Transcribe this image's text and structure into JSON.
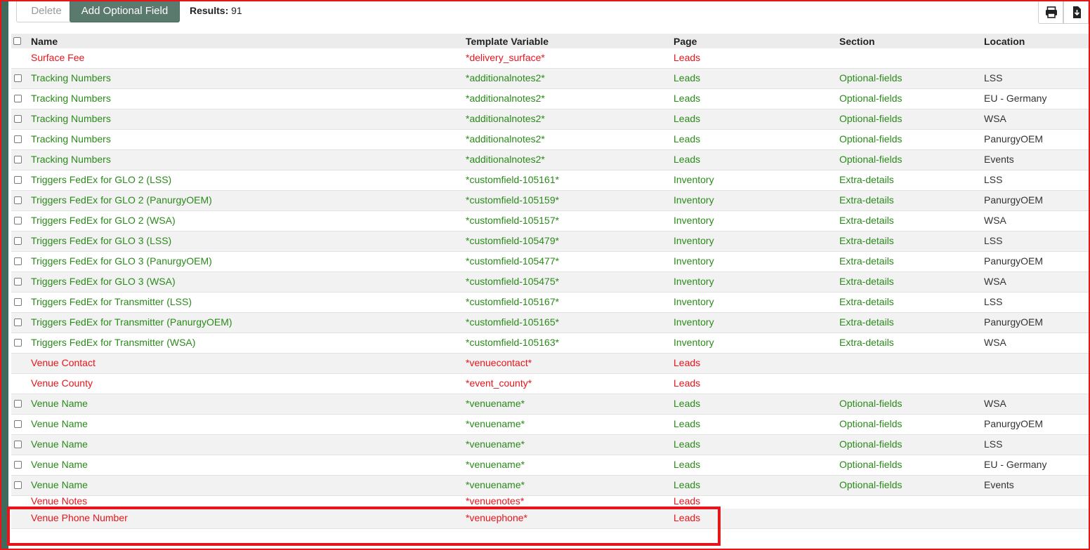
{
  "toolbar": {
    "delete_label": "Delete",
    "add_label": "Add Optional Field",
    "results_label": "Results:",
    "results_count": "91"
  },
  "table": {
    "headers": {
      "name": "Name",
      "variable": "Template Variable",
      "page": "Page",
      "section": "Section",
      "location": "Location"
    },
    "rows": [
      {
        "name": "Surface Fee",
        "variable": "*delivery_surface*",
        "page": "Leads",
        "section": "",
        "location": ""
      },
      {
        "name": "Tracking Numbers",
        "variable": "*additionalnotes2*",
        "page": "Leads",
        "section": "Optional-fields",
        "location": "LSS"
      },
      {
        "name": "Tracking Numbers",
        "variable": "*additionalnotes2*",
        "page": "Leads",
        "section": "Optional-fields",
        "location": "EU - Germany"
      },
      {
        "name": "Tracking Numbers",
        "variable": "*additionalnotes2*",
        "page": "Leads",
        "section": "Optional-fields",
        "location": "WSA"
      },
      {
        "name": "Tracking Numbers",
        "variable": "*additionalnotes2*",
        "page": "Leads",
        "section": "Optional-fields",
        "location": "PanurgyOEM"
      },
      {
        "name": "Tracking Numbers",
        "variable": "*additionalnotes2*",
        "page": "Leads",
        "section": "Optional-fields",
        "location": "Events"
      },
      {
        "name": "Triggers FedEx for GLO 2 (LSS)",
        "variable": "*customfield-105161*",
        "page": "Inventory",
        "section": "Extra-details",
        "location": "LSS"
      },
      {
        "name": "Triggers FedEx for GLO 2 (PanurgyOEM)",
        "variable": "*customfield-105159*",
        "page": "Inventory",
        "section": "Extra-details",
        "location": "PanurgyOEM"
      },
      {
        "name": "Triggers FedEx for GLO 2 (WSA)",
        "variable": "*customfield-105157*",
        "page": "Inventory",
        "section": "Extra-details",
        "location": "WSA"
      },
      {
        "name": "Triggers FedEx for GLO 3 (LSS)",
        "variable": "*customfield-105479*",
        "page": "Inventory",
        "section": "Extra-details",
        "location": "LSS"
      },
      {
        "name": "Triggers FedEx for GLO 3 (PanurgyOEM)",
        "variable": "*customfield-105477*",
        "page": "Inventory",
        "section": "Extra-details",
        "location": "PanurgyOEM"
      },
      {
        "name": "Triggers FedEx for GLO 3 (WSA)",
        "variable": "*customfield-105475*",
        "page": "Inventory",
        "section": "Extra-details",
        "location": "WSA"
      },
      {
        "name": "Triggers FedEx for Transmitter (LSS)",
        "variable": "*customfield-105167*",
        "page": "Inventory",
        "section": "Extra-details",
        "location": "LSS"
      },
      {
        "name": "Triggers FedEx for Transmitter (PanurgyOEM)",
        "variable": "*customfield-105165*",
        "page": "Inventory",
        "section": "Extra-details",
        "location": "PanurgyOEM"
      },
      {
        "name": "Triggers FedEx for Transmitter (WSA)",
        "variable": "*customfield-105163*",
        "page": "Inventory",
        "section": "Extra-details",
        "location": "WSA"
      },
      {
        "name": "Venue Contact",
        "variable": "*venuecontact*",
        "page": "Leads",
        "section": "",
        "location": ""
      },
      {
        "name": "Venue County",
        "variable": "*event_county*",
        "page": "Leads",
        "section": "",
        "location": ""
      },
      {
        "name": "Venue Name",
        "variable": "*venuename*",
        "page": "Leads",
        "section": "Optional-fields",
        "location": "WSA"
      },
      {
        "name": "Venue Name",
        "variable": "*venuename*",
        "page": "Leads",
        "section": "Optional-fields",
        "location": "PanurgyOEM"
      },
      {
        "name": "Venue Name",
        "variable": "*venuename*",
        "page": "Leads",
        "section": "Optional-fields",
        "location": "LSS"
      },
      {
        "name": "Venue Name",
        "variable": "*venuename*",
        "page": "Leads",
        "section": "Optional-fields",
        "location": "EU - Germany"
      },
      {
        "name": "Venue Name",
        "variable": "*venuename*",
        "page": "Leads",
        "section": "Optional-fields",
        "location": "Events"
      },
      {
        "name": "Venue Notes",
        "variable": "*venuenotes*",
        "page": "Leads",
        "section": "",
        "location": ""
      },
      {
        "name": "Venue Phone Number",
        "variable": "*venuephone*",
        "page": "Leads",
        "section": "",
        "location": ""
      }
    ]
  },
  "colors": {
    "system_field": "#e8141b",
    "custom_field": "#2a8a1a",
    "add_button": "#5b7a6e",
    "highlight": "#e8141b"
  },
  "icons": {
    "print": "print-icon",
    "export": "export-icon"
  }
}
